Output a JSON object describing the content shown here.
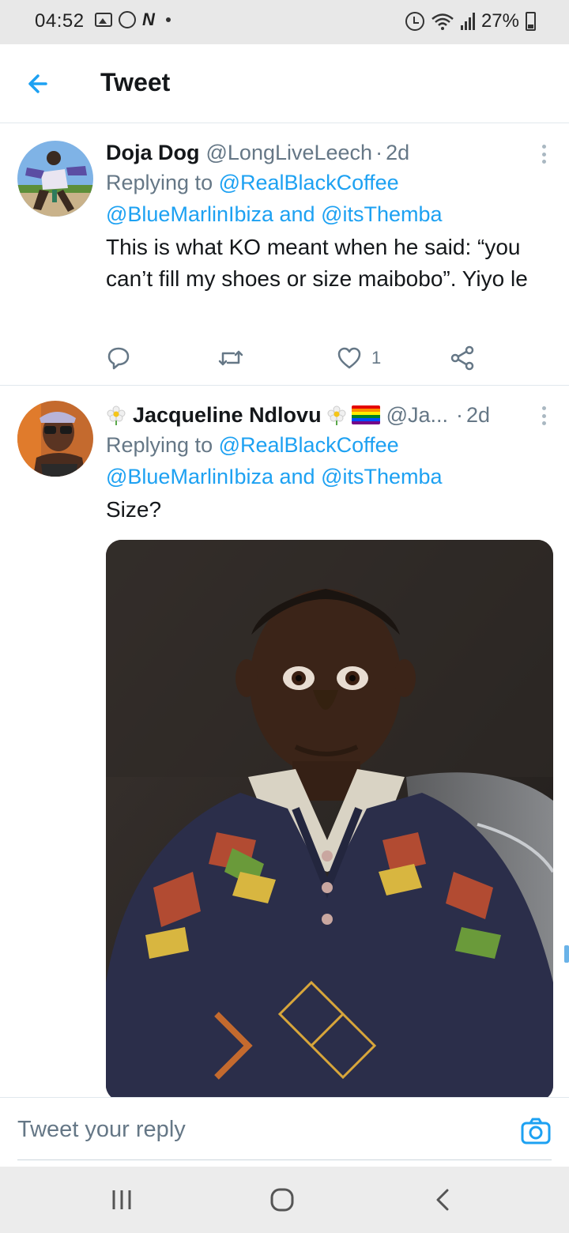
{
  "status_bar": {
    "time": "04:52",
    "battery": "27%",
    "icons": [
      "image-icon",
      "whatsapp-icon",
      "netflix-n-icon",
      "notification-dot",
      "alarm-icon",
      "wifi-icon",
      "signal-icon",
      "battery-icon"
    ],
    "battery_level": 0.27
  },
  "header": {
    "back_icon": "arrow-left-icon",
    "title": "Tweet"
  },
  "tweets": [
    {
      "display_name": "Doja Dog",
      "handle": "@LongLiveLeech",
      "separator": "·",
      "time": "2d",
      "replying_to_label": "Replying to",
      "reply_handle_1": "@RealBlackCoffee",
      "reply_handle_2": "@BlueMarlinIbiza",
      "reply_and": "and",
      "reply_handle_3": "@itsThemba",
      "text": "This is what KO meant when he said: “you can’t fill my shoes or size maibobo”. Yiyo le",
      "actions": {
        "reply_icon": "reply-icon",
        "retweet_icon": "retweet-icon",
        "like_icon": "heart-icon",
        "like_count": "1",
        "share_icon": "share-icon"
      }
    },
    {
      "display_name": "Jacqueline Ndlovu",
      "name_decorations": [
        "flower-emoji",
        "flower-emoji",
        "rainbow-flag-emoji"
      ],
      "handle": "@Ja...",
      "separator": "·",
      "time": "2d",
      "replying_to_label": "Replying to",
      "reply_handle_1": "@RealBlackCoffee",
      "reply_handle_2": "@BlueMarlinIbiza",
      "reply_and": "and",
      "reply_handle_3": "@itsThemba",
      "text": "Size?"
    }
  ],
  "reply_bar": {
    "placeholder": "Tweet your reply",
    "camera_icon": "camera-icon"
  },
  "nav_bar": {
    "icons": [
      "recent-apps-icon",
      "home-icon",
      "back-icon"
    ]
  },
  "colors": {
    "accent": "#1da1f2",
    "secondary_text": "#657786",
    "primary_text": "#14171a",
    "divider": "#e1e8ed"
  }
}
